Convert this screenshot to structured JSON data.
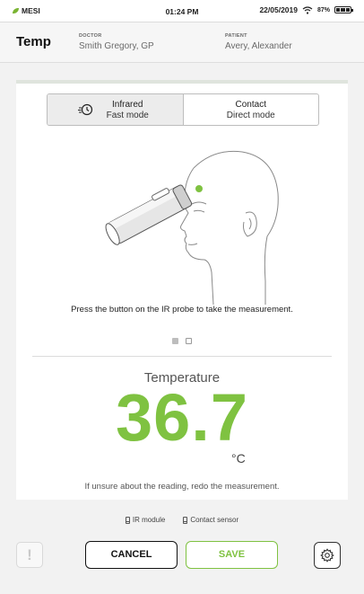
{
  "status_bar": {
    "brand": "MESI",
    "time": "01:24 PM",
    "date": "22/05/2019",
    "battery_percent": "87%",
    "icons": [
      "wifi-icon",
      "battery-icon"
    ]
  },
  "header": {
    "title": "Temp",
    "doctor_label": "DOCTOR",
    "doctor_name": "Smith Gregory, GP",
    "patient_label": "PATIENT",
    "patient_name": "Avery, Alexander"
  },
  "mode_toggle": {
    "selected": "infrared",
    "options": [
      {
        "id": "infrared",
        "title": "Infrared",
        "subtitle": "Fast mode",
        "icon": "fast-history-icon"
      },
      {
        "id": "contact",
        "title": "Contact",
        "subtitle": "Direct mode"
      }
    ]
  },
  "instruction": "Press the button on the IR probe to take the measurement.",
  "pager": {
    "count": 2,
    "active_index": 0
  },
  "measurement": {
    "label": "Temperature",
    "value": "36.7",
    "unit": "°C",
    "advice": "If unsure about the reading, redo the measurement."
  },
  "sensors": [
    {
      "label": "IR module",
      "icon": "module-icon"
    },
    {
      "label": "Contact sensor",
      "icon": "module-icon"
    }
  ],
  "footer": {
    "cancel_label": "CANCEL",
    "save_label": "SAVE",
    "alert_glyph": "!",
    "icons": [
      "alert-icon",
      "gear-icon"
    ]
  },
  "colors": {
    "accent": "#7fc241",
    "background": "#f2f2f2",
    "card": "#ffffff"
  }
}
